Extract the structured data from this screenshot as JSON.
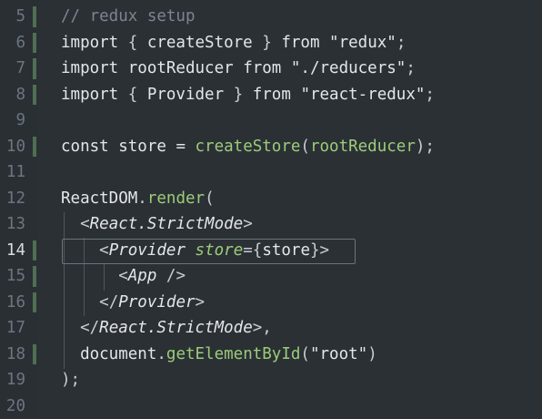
{
  "editor": {
    "lines": [
      {
        "number": "5",
        "parts": [
          {
            "text": "// redux setup",
            "kind": "comment"
          }
        ]
      },
      {
        "number": "6",
        "parts": [
          {
            "text": "import",
            "kind": "kw"
          },
          {
            "text": " { ",
            "kind": "punct"
          },
          {
            "text": "createStore",
            "kind": "plain"
          },
          {
            "text": " } ",
            "kind": "punct"
          },
          {
            "text": "from",
            "kind": "kw"
          },
          {
            "text": " ",
            "kind": "plain"
          },
          {
            "text": "\"redux\"",
            "kind": "str"
          },
          {
            "text": ";",
            "kind": "punct"
          }
        ]
      },
      {
        "number": "7",
        "parts": [
          {
            "text": "import",
            "kind": "kw"
          },
          {
            "text": " rootReducer ",
            "kind": "plain"
          },
          {
            "text": "from",
            "kind": "kw"
          },
          {
            "text": " ",
            "kind": "plain"
          },
          {
            "text": "\"./reducers\"",
            "kind": "str"
          },
          {
            "text": ";",
            "kind": "punct"
          }
        ]
      },
      {
        "number": "8",
        "parts": [
          {
            "text": "import",
            "kind": "kw"
          },
          {
            "text": " { ",
            "kind": "punct"
          },
          {
            "text": "Provider",
            "kind": "plain"
          },
          {
            "text": " } ",
            "kind": "punct"
          },
          {
            "text": "from",
            "kind": "kw"
          },
          {
            "text": " ",
            "kind": "plain"
          },
          {
            "text": "\"react-redux\"",
            "kind": "str"
          },
          {
            "text": ";",
            "kind": "punct"
          }
        ]
      },
      {
        "number": "9",
        "parts": []
      },
      {
        "number": "10",
        "parts": [
          {
            "text": "const",
            "kind": "kw"
          },
          {
            "text": " store = ",
            "kind": "plain"
          },
          {
            "text": "createStore",
            "kind": "fn"
          },
          {
            "text": "(",
            "kind": "punct"
          },
          {
            "text": "rootReducer",
            "kind": "fn"
          },
          {
            "text": ");",
            "kind": "punct"
          }
        ]
      },
      {
        "number": "11",
        "parts": []
      },
      {
        "number": "12",
        "parts": [
          {
            "text": "ReactDOM",
            "kind": "plain"
          },
          {
            "text": ".",
            "kind": "punct"
          },
          {
            "text": "render",
            "kind": "fn"
          },
          {
            "text": "(",
            "kind": "punct"
          }
        ]
      },
      {
        "number": "13",
        "parts": [
          {
            "text": "  ",
            "kind": "plain"
          },
          {
            "text": "<",
            "kind": "punct"
          },
          {
            "text": "React.StrictMode",
            "kind": "tag"
          },
          {
            "text": ">",
            "kind": "punct"
          }
        ]
      },
      {
        "number": "14",
        "parts": [
          {
            "text": "    ",
            "kind": "plain"
          },
          {
            "text": "<",
            "kind": "punct"
          },
          {
            "text": "Provider",
            "kind": "tag"
          },
          {
            "text": " ",
            "kind": "plain"
          },
          {
            "text": "store",
            "kind": "attr"
          },
          {
            "text": "={",
            "kind": "punct"
          },
          {
            "text": "store",
            "kind": "plain"
          },
          {
            "text": "}",
            "kind": "punct"
          },
          {
            "text": ">",
            "kind": "punct"
          }
        ]
      },
      {
        "number": "15",
        "parts": [
          {
            "text": "      ",
            "kind": "plain"
          },
          {
            "text": "<",
            "kind": "punct"
          },
          {
            "text": "App",
            "kind": "tag"
          },
          {
            "text": " />",
            "kind": "punct"
          }
        ]
      },
      {
        "number": "16",
        "parts": [
          {
            "text": "    ",
            "kind": "plain"
          },
          {
            "text": "</",
            "kind": "punct"
          },
          {
            "text": "Provider",
            "kind": "tag"
          },
          {
            "text": ">",
            "kind": "punct"
          }
        ]
      },
      {
        "number": "17",
        "parts": [
          {
            "text": "  ",
            "kind": "plain"
          },
          {
            "text": "</",
            "kind": "punct"
          },
          {
            "text": "React.StrictMode",
            "kind": "tag"
          },
          {
            "text": ">,",
            "kind": "punct"
          }
        ]
      },
      {
        "number": "18",
        "parts": [
          {
            "text": "  document",
            "kind": "plain"
          },
          {
            "text": ".",
            "kind": "punct"
          },
          {
            "text": "getElementById",
            "kind": "fn"
          },
          {
            "text": "(",
            "kind": "punct"
          },
          {
            "text": "\"root\"",
            "kind": "str"
          },
          {
            "text": ")",
            "kind": "punct"
          }
        ]
      },
      {
        "number": "19",
        "parts": [
          {
            "text": ");",
            "kind": "punct"
          }
        ]
      },
      {
        "number": "20",
        "parts": []
      }
    ],
    "active_line": "14",
    "modified_lines": [
      "5",
      "6",
      "7",
      "8",
      "10",
      "14",
      "15",
      "16",
      "18"
    ],
    "colors": {
      "background": "#2b3035",
      "function": "#9ccc7a",
      "comment": "#7b8591",
      "modified_marker": "#4f6f52"
    }
  }
}
